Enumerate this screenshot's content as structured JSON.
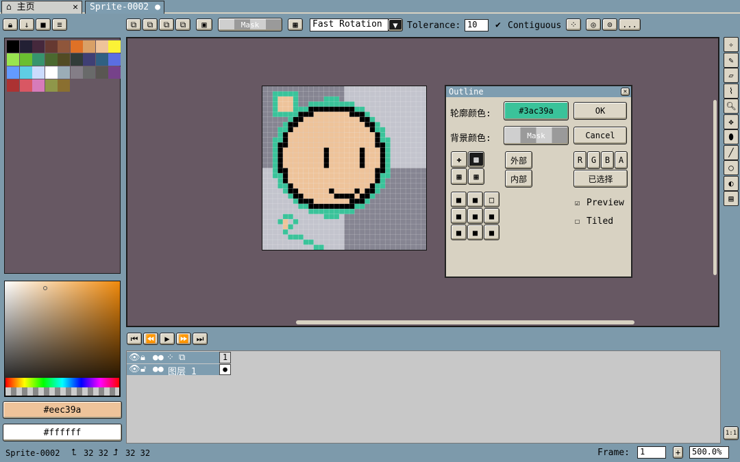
{
  "tabs": {
    "home": "主页",
    "home_close": "✕",
    "sprite": "Sprite-0002",
    "sprite_dot": "●"
  },
  "toolbar": {
    "mask_label": "Mask",
    "rotation": "Fast Rotation",
    "tolerance_label": "Tolerance:",
    "tolerance_value": "10",
    "contiguous_label": "Contiguous",
    "more": "..."
  },
  "colors": {
    "fg": "#eec39a",
    "bg": "#ffffff",
    "bg_panel": "#675863",
    "accent": "#3ac39a"
  },
  "palette": [
    "#000000",
    "#222034",
    "#45283c",
    "#663931",
    "#8f563b",
    "#df7126",
    "#d9a066",
    "#eec39a",
    "#fbf236",
    "#99e550",
    "#6abe30",
    "#37946e",
    "#4b692f",
    "#524b24",
    "#323c39",
    "#3f3f74",
    "#306082",
    "#5b6ee1",
    "#639bff",
    "#5fcde4",
    "#cbdbfc",
    "#ffffff",
    "#9badb7",
    "#847e87",
    "#696a6a",
    "#595652",
    "#76428a",
    "#ac3232",
    "#d95763",
    "#d77bba",
    "#8f974a",
    "#8a6f30"
  ],
  "color_hex": {
    "fg": "#eec39a",
    "bg": "#ffffff"
  },
  "outline": {
    "title": "Outline",
    "outline_color_label": "轮廓颜色:",
    "outline_color_value": "#3ac39a",
    "bg_color_label": "背景颜色:",
    "bg_color_value": "Mask",
    "ok": "OK",
    "cancel": "Cancel",
    "outside": "外部",
    "inside": "内部",
    "channels": [
      "R",
      "G",
      "B",
      "A"
    ],
    "selected": "已选择",
    "preview": "Preview",
    "tiled": "Tiled"
  },
  "layers": {
    "name": "图层 1",
    "frame": "1"
  },
  "status": {
    "file": "Sprite-0002",
    "size1": "32 32",
    "size2": "32 32",
    "frame_label": "Frame:",
    "frame_value": "1",
    "zoom": "500.0%"
  }
}
